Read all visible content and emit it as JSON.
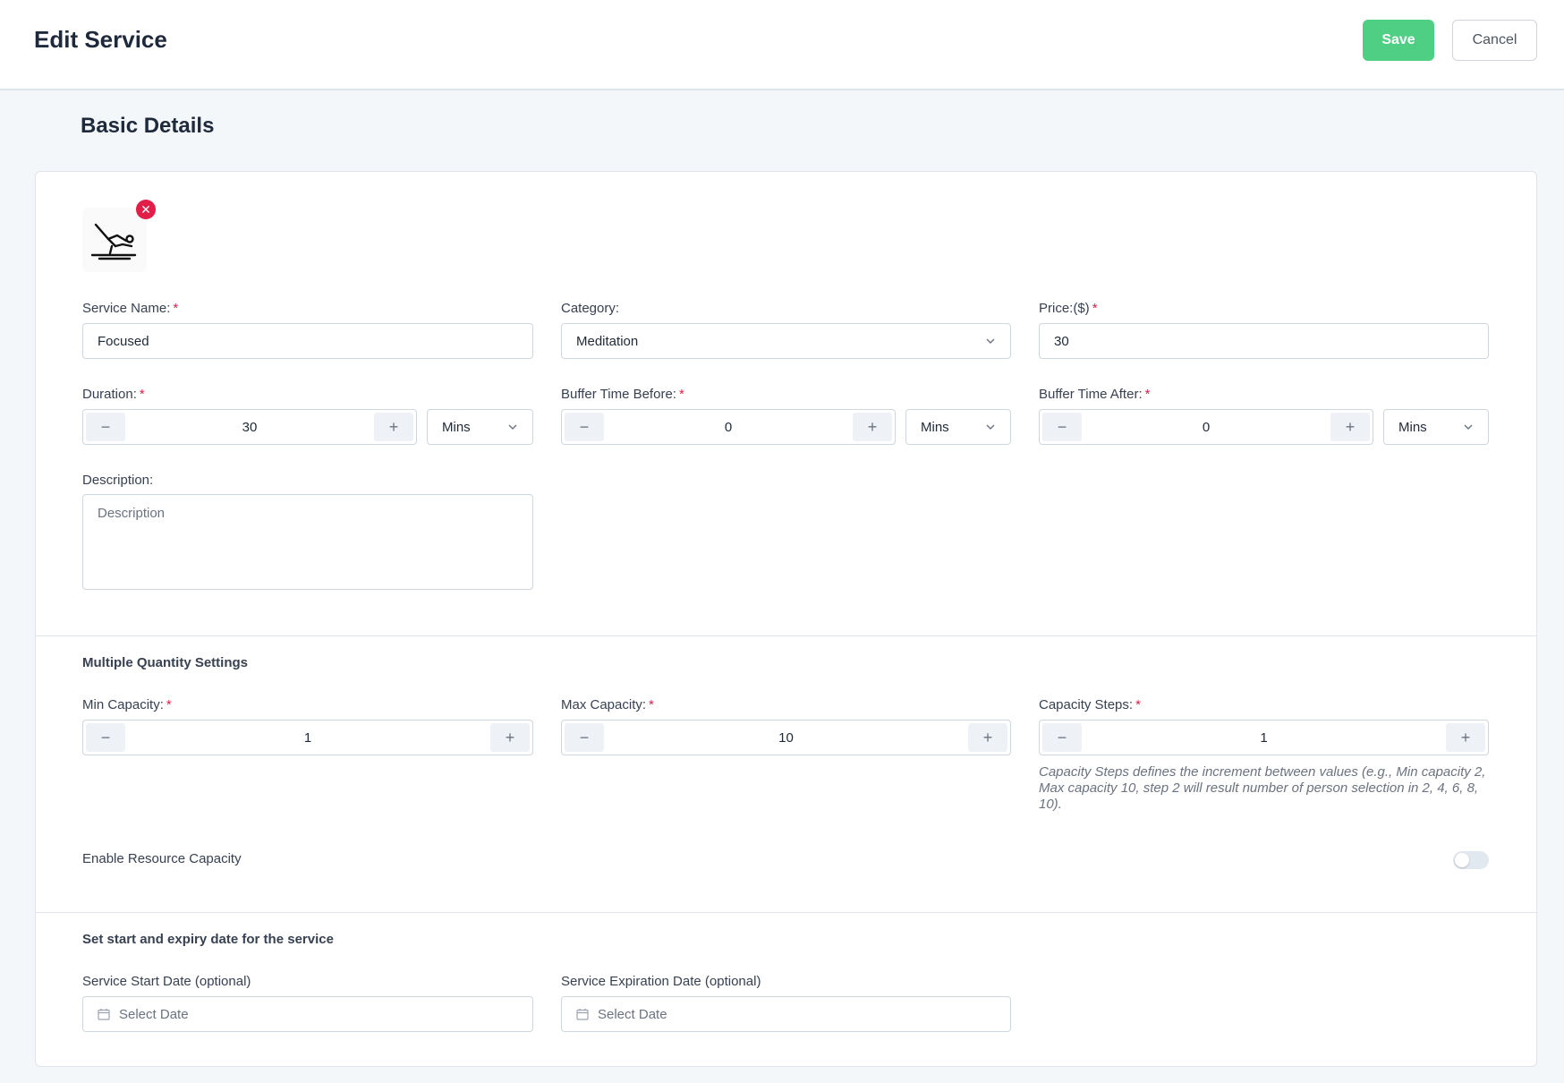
{
  "header": {
    "title": "Edit Service",
    "save_label": "Save",
    "cancel_label": "Cancel"
  },
  "section_title": "Basic Details",
  "image": {
    "remove_symbol": "✕",
    "icon": "pilates-exercise-icon"
  },
  "fields": {
    "service_name": {
      "label": "Service Name:",
      "required": "*",
      "value": "Focused"
    },
    "category": {
      "label": "Category:",
      "value": "Meditation"
    },
    "price": {
      "label": "Price:($)",
      "required": "*",
      "value": "30"
    },
    "duration": {
      "label": "Duration:",
      "required": "*",
      "value": "30",
      "unit": "Mins"
    },
    "buffer_before": {
      "label": "Buffer Time Before:",
      "required": "*",
      "value": "0",
      "unit": "Mins"
    },
    "buffer_after": {
      "label": "Buffer Time After:",
      "required": "*",
      "value": "0",
      "unit": "Mins"
    },
    "description": {
      "label": "Description:",
      "placeholder": "Description",
      "value": ""
    }
  },
  "stepper": {
    "minus": "−",
    "plus": "+"
  },
  "quantity": {
    "title": "Multiple Quantity Settings",
    "min_capacity": {
      "label": "Min Capacity:",
      "required": "*",
      "value": "1"
    },
    "max_capacity": {
      "label": "Max Capacity:",
      "required": "*",
      "value": "10"
    },
    "capacity_steps": {
      "label": "Capacity Steps:",
      "required": "*",
      "value": "1"
    },
    "hint": "Capacity Steps defines the increment between values (e.g., Min capacity 2, Max capacity 10, step 2 will result number of person selection in 2, 4, 6, 8, 10).",
    "resource_capacity": {
      "label": "Enable Resource Capacity",
      "enabled": false
    }
  },
  "dates": {
    "title": "Set start and expiry date for the service",
    "start": {
      "label": "Service Start Date (optional)",
      "placeholder": "Select Date"
    },
    "expiry": {
      "label": "Service Expiration Date (optional)",
      "placeholder": "Select Date"
    }
  },
  "colors": {
    "save": "#4ecf83",
    "required": "#e11d48",
    "remove": "#e11d48"
  }
}
